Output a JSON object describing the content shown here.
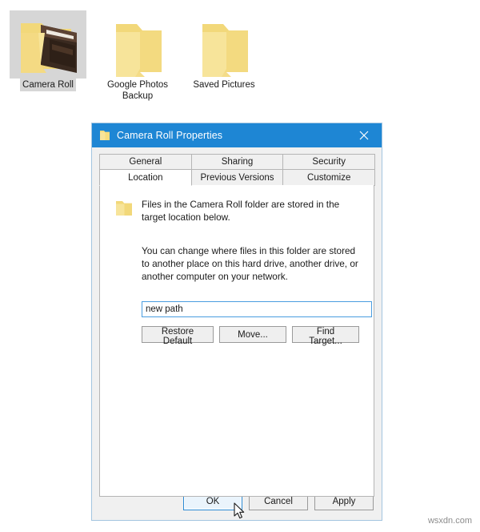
{
  "desktop": {
    "icons": [
      {
        "label": "Camera Roll",
        "icon": "folder-with-photo-thumbnail-icon",
        "selected": true
      },
      {
        "label": "Google Photos Backup",
        "icon": "folder-icon",
        "selected": false
      },
      {
        "label": "Saved Pictures",
        "icon": "folder-icon",
        "selected": false
      }
    ]
  },
  "dialog": {
    "title": "Camera Roll Properties",
    "title_icon": "folder-icon",
    "close_icon": "close-icon",
    "tabs_row1": [
      {
        "label": "General",
        "active": false
      },
      {
        "label": "Sharing",
        "active": false
      },
      {
        "label": "Security",
        "active": false
      }
    ],
    "tabs_row2": [
      {
        "label": "Location",
        "active": true
      },
      {
        "label": "Previous Versions",
        "active": false
      },
      {
        "label": "Customize",
        "active": false
      }
    ],
    "content": {
      "folder_icon": "folder-icon",
      "paragraph1": "Files in the Camera Roll folder are stored in the target location below.",
      "paragraph2": "You can change where files in this folder are stored to another place on this hard drive, another drive, or another computer on your network.",
      "path_value": "new path",
      "path_placeholder": "",
      "buttons": [
        {
          "label": "Restore Default"
        },
        {
          "label": "Move..."
        },
        {
          "label": "Find Target..."
        }
      ]
    },
    "footer_buttons": [
      {
        "label": "OK",
        "default": true
      },
      {
        "label": "Cancel",
        "default": false
      },
      {
        "label": "Apply",
        "default": false
      }
    ]
  },
  "watermark": "wsxdn.com",
  "colors": {
    "titlebar": "#1e86d4",
    "dialog_bg": "#f0f0f0",
    "panel_bg": "#ffffff",
    "folder_yellow": "#f5dd7e",
    "focus_blue": "#4a9de0",
    "desktop_bg": "#ffffff"
  }
}
